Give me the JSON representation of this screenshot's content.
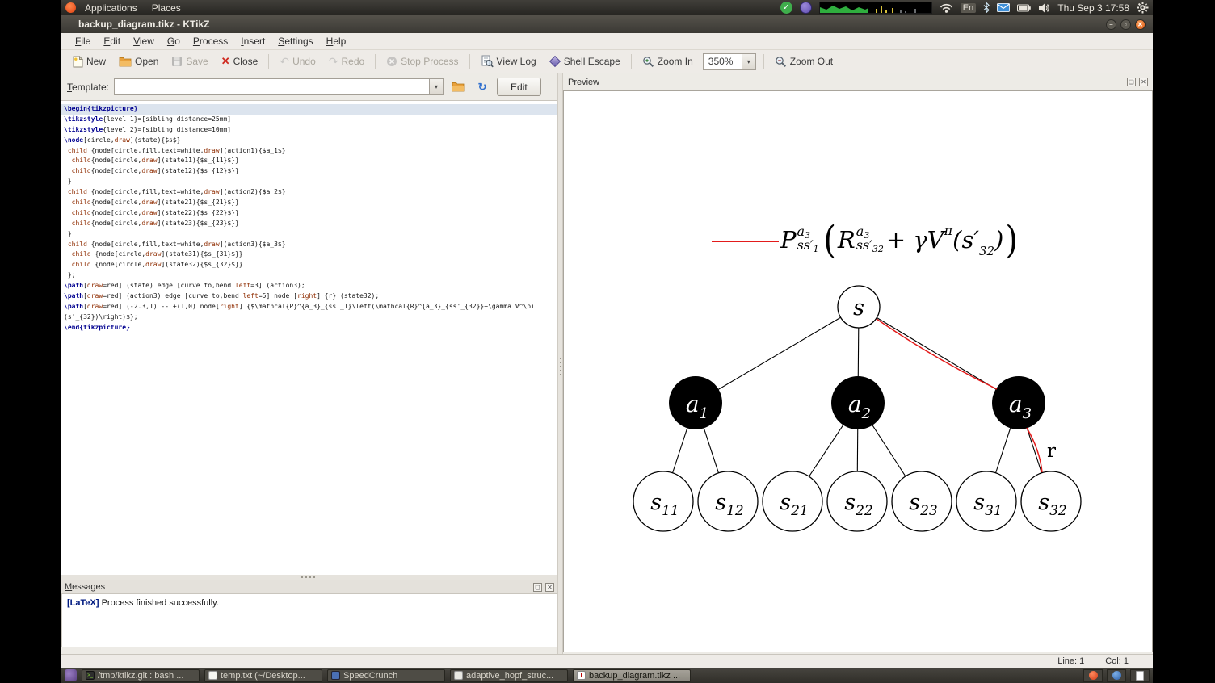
{
  "panel": {
    "applications": "Applications",
    "places": "Places",
    "keyboard": "En",
    "clock": "Thu Sep 3 17:58"
  },
  "window": {
    "title": "backup_diagram.tikz - KTikZ",
    "menus": [
      "File",
      "Edit",
      "View",
      "Go",
      "Process",
      "Insert",
      "Settings",
      "Help"
    ],
    "toolbar": {
      "new": "New",
      "open": "Open",
      "save": "Save",
      "close": "Close",
      "undo": "Undo",
      "redo": "Redo",
      "stop": "Stop Process",
      "view_log": "View Log",
      "shell_escape": "Shell Escape",
      "zoom_in": "Zoom In",
      "zoom_value": "350%",
      "zoom_out": "Zoom Out"
    },
    "template_label": "Template:",
    "template_value": "",
    "edit_button": "Edit",
    "preview_title": "Preview",
    "messages_title": "Messages",
    "log_tag": "[LaTeX]",
    "log_message": " Process finished successfully.",
    "status_line": "Line: 1",
    "status_col": "Col: 1"
  },
  "editor": {
    "lines": [
      [
        [
          "\\begin{tikzpicture}",
          "kw"
        ]
      ],
      [
        [
          "\\tikzstyle",
          "kw"
        ],
        [
          "{level 1}=[sibling distance=25mm]",
          "p"
        ]
      ],
      [
        [
          "\\tikzstyle",
          "kw"
        ],
        [
          "{level 2}=[sibling distance=10mm]",
          "p"
        ]
      ],
      [
        [
          "\\node",
          "kw"
        ],
        [
          "[circle,",
          "p"
        ],
        [
          "draw",
          "o"
        ],
        [
          "](state){$s$}",
          "p"
        ]
      ],
      [
        [
          " ",
          "p"
        ],
        [
          "child",
          "c"
        ],
        [
          " {node[circle,fill,text=white,",
          "p"
        ],
        [
          "draw",
          "o"
        ],
        [
          "](action1){$a_1$}",
          "p"
        ]
      ],
      [
        [
          "  ",
          "p"
        ],
        [
          "child",
          "c"
        ],
        [
          "{node[circle,",
          "p"
        ],
        [
          "draw",
          "o"
        ],
        [
          "](state11){$s_{11}$}}",
          "p"
        ]
      ],
      [
        [
          "  ",
          "p"
        ],
        [
          "child",
          "c"
        ],
        [
          "{node[circle,",
          "p"
        ],
        [
          "draw",
          "o"
        ],
        [
          "](state12){$s_{12}$}}",
          "p"
        ]
      ],
      [
        [
          " }",
          "p"
        ]
      ],
      [
        [
          " ",
          "p"
        ],
        [
          "child",
          "c"
        ],
        [
          " {node[circle,fill,text=white,",
          "p"
        ],
        [
          "draw",
          "o"
        ],
        [
          "](action2){$a_2$}",
          "p"
        ]
      ],
      [
        [
          "  ",
          "p"
        ],
        [
          "child",
          "c"
        ],
        [
          "{node[circle,",
          "p"
        ],
        [
          "draw",
          "o"
        ],
        [
          "](state21){$s_{21}$}}",
          "p"
        ]
      ],
      [
        [
          "  ",
          "p"
        ],
        [
          "child",
          "c"
        ],
        [
          "{node[circle,",
          "p"
        ],
        [
          "draw",
          "o"
        ],
        [
          "](state22){$s_{22}$}}",
          "p"
        ]
      ],
      [
        [
          "  ",
          "p"
        ],
        [
          "child",
          "c"
        ],
        [
          "{node[circle,",
          "p"
        ],
        [
          "draw",
          "o"
        ],
        [
          "](state23){$s_{23}$}}",
          "p"
        ]
      ],
      [
        [
          " }",
          "p"
        ]
      ],
      [
        [
          " ",
          "p"
        ],
        [
          "child",
          "c"
        ],
        [
          " {node[circle,fill,text=white,",
          "p"
        ],
        [
          "draw",
          "o"
        ],
        [
          "](action3){$a_3$}",
          "p"
        ]
      ],
      [
        [
          "  ",
          "p"
        ],
        [
          "child",
          "c"
        ],
        [
          " {node[circle,",
          "p"
        ],
        [
          "draw",
          "o"
        ],
        [
          "](state31){$s_{31}$}}",
          "p"
        ]
      ],
      [
        [
          "  ",
          "p"
        ],
        [
          "child",
          "c"
        ],
        [
          " {node[circle,",
          "p"
        ],
        [
          "draw",
          "o"
        ],
        [
          "](state32){$s_{32}$}}",
          "p"
        ]
      ],
      [
        [
          " };",
          "p"
        ]
      ],
      [
        [
          "\\path",
          "kw"
        ],
        [
          "[",
          "p"
        ],
        [
          "draw",
          "o"
        ],
        [
          "=red] (state) edge [curve to,bend ",
          "p"
        ],
        [
          "left",
          "o"
        ],
        [
          "=3] (action3);",
          "p"
        ]
      ],
      [
        [
          "\\path",
          "kw"
        ],
        [
          "[",
          "p"
        ],
        [
          "draw",
          "o"
        ],
        [
          "=red] (action3) edge [curve to,bend ",
          "p"
        ],
        [
          "left",
          "o"
        ],
        [
          "=5] node [",
          "p"
        ],
        [
          "right",
          "o"
        ],
        [
          "] {r} (state32);",
          "p"
        ]
      ],
      [
        [
          "\\path",
          "kw"
        ],
        [
          "[",
          "p"
        ],
        [
          "draw",
          "o"
        ],
        [
          "=red] (-2.3,1) -- +(1,0) node[",
          "p"
        ],
        [
          "right",
          "o"
        ],
        [
          "] {$\\mathcal{P}^{a_3}_{ss'_1}\\left(\\mathcal{R}^{a_3}_{ss'_{32}}+\\gamma V^\\pi",
          "p"
        ]
      ],
      [
        [
          "(s'_{32})\\right)$};",
          "p"
        ]
      ],
      [
        [
          "\\end{tikzpicture}",
          "kw"
        ]
      ]
    ]
  },
  "diagram": {
    "colors": {
      "edge_red": "#e31b1b",
      "node_fill": "#000000"
    },
    "nodes": {
      "root": {
        "base": "s",
        "sub": ""
      },
      "a1": {
        "base": "a",
        "sub": "1"
      },
      "a2": {
        "base": "a",
        "sub": "2"
      },
      "a3": {
        "base": "a",
        "sub": "3"
      },
      "s11": {
        "base": "s",
        "sub": "11"
      },
      "s12": {
        "base": "s",
        "sub": "12"
      },
      "s21": {
        "base": "s",
        "sub": "21"
      },
      "s22": {
        "base": "s",
        "sub": "22"
      },
      "s23": {
        "base": "s",
        "sub": "23"
      },
      "s31": {
        "base": "s",
        "sub": "31"
      },
      "s32": {
        "base": "s",
        "sub": "32"
      }
    },
    "edge_label": "r",
    "formula": {
      "p": "P",
      "p_sup_base": "a",
      "p_sup_idx": "3",
      "p_sub_base": "ss′",
      "p_sub_idx": "1",
      "lparen": "(",
      "r": "R",
      "r_sup_base": "a",
      "r_sup_idx": "3",
      "r_sub_base": "ss′",
      "r_sub_idx": "32",
      "mid": "+ γV",
      "v_sup": "π",
      "arg_open": "(s′",
      "arg_idx": "32",
      "arg_close": ")",
      "rparen": ")"
    }
  },
  "taskbar": {
    "items": [
      {
        "label": "/tmp/ktikz.git : bash ..."
      },
      {
        "label": "temp.txt (~/Desktop..."
      },
      {
        "label": "SpeedCrunch"
      },
      {
        "label": "adaptive_hopf_struc..."
      },
      {
        "label": "backup_diagram.tikz ..."
      }
    ]
  }
}
